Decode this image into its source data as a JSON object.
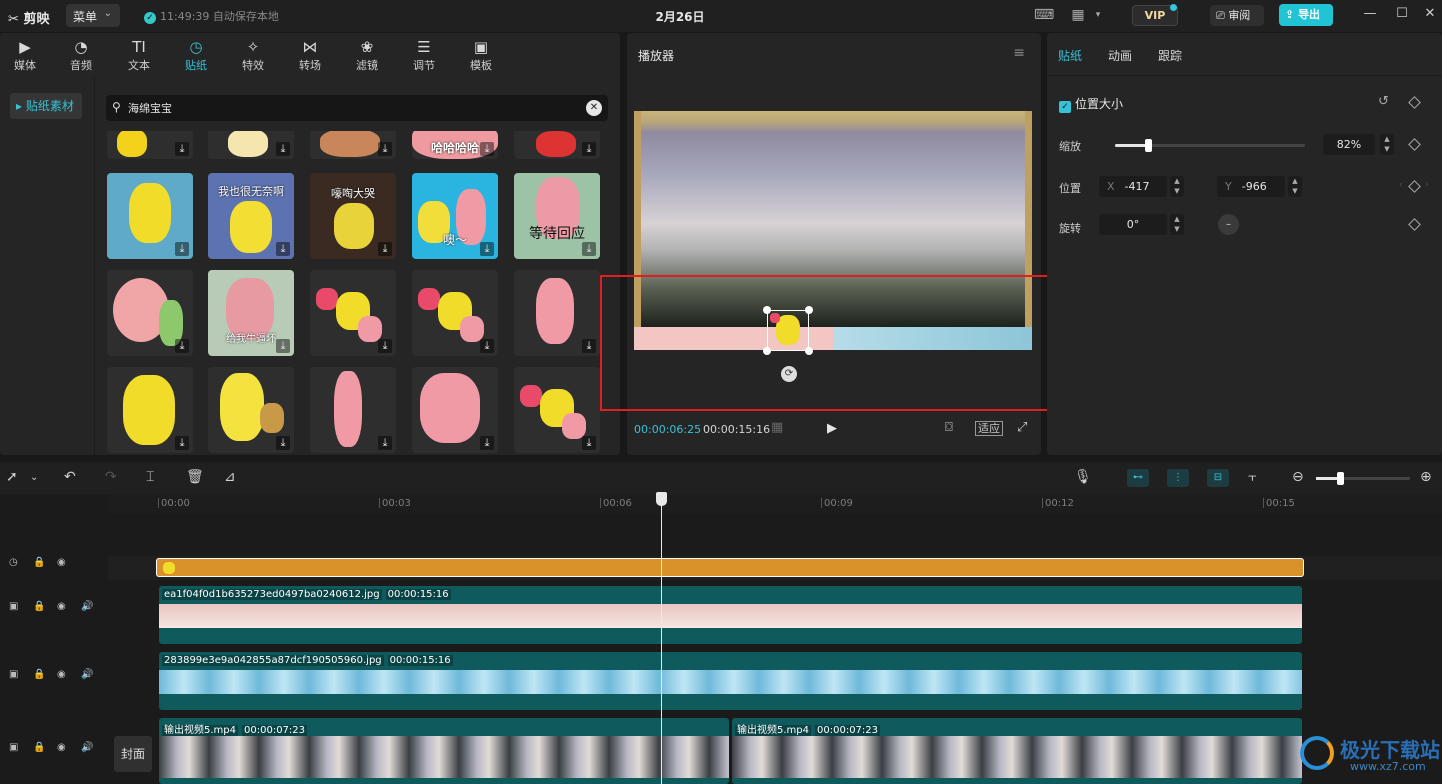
{
  "app": {
    "logo": "剪映",
    "menu_label": "菜单",
    "save_status": "11:49:39 自动保存本地",
    "project_title": "2月26日",
    "vip_label": "VIP",
    "review_label": "审阅",
    "export_label": "导出"
  },
  "media_tabs": [
    {
      "label": "媒体",
      "icon": "media-icon"
    },
    {
      "label": "音频",
      "icon": "audio-icon"
    },
    {
      "label": "文本",
      "icon": "text-icon",
      "glyph": "TI"
    },
    {
      "label": "贴纸",
      "icon": "sticker-icon",
      "active": true
    },
    {
      "label": "特效",
      "icon": "effects-icon"
    },
    {
      "label": "转场",
      "icon": "transition-icon"
    },
    {
      "label": "滤镜",
      "icon": "filter-icon"
    },
    {
      "label": "调节",
      "icon": "adjust-icon"
    },
    {
      "label": "模板",
      "icon": "template-icon"
    }
  ],
  "sidebar": {
    "items": [
      {
        "label": "贴纸素材"
      }
    ]
  },
  "search": {
    "value": "海绵宝宝"
  },
  "stickers": {
    "captions": [
      "我也很无奈啊",
      "嚎啕大哭",
      "噢～",
      "等待回应",
      "给我牛逼坏",
      "哈哈哈哈"
    ]
  },
  "player": {
    "title": "播放器",
    "current_time": "00:00:06:25",
    "total_time": "00:00:15:16",
    "fit_label": "适应"
  },
  "props": {
    "tabs": [
      "贴纸",
      "动画",
      "跟踪"
    ],
    "section_title": "位置大小",
    "scale_label": "缩放",
    "scale_value": "82%",
    "scale_fraction": 0.82,
    "position_label": "位置",
    "x_label": "X",
    "x_value": "-417",
    "y_label": "Y",
    "y_value": "-966",
    "rotate_label": "旋转",
    "rotate_value": "0°"
  },
  "timeline": {
    "ruler": [
      "00:00",
      "00:03",
      "00:06",
      "00:09",
      "00:12",
      "00:15"
    ],
    "cover_label": "封面",
    "clips": [
      {
        "name": "ea1f04f0d1b635273ed0497ba0240612.jpg",
        "duration": "00:00:15:16"
      },
      {
        "name": "283899e3e9a042855a87dcf190505960.jpg",
        "duration": "00:00:15:16"
      },
      {
        "name": "输出视频5.mp4",
        "duration": "00:00:07:23"
      },
      {
        "name": "输出视频5.mp4",
        "duration": "00:00:07:23"
      }
    ]
  },
  "watermark": {
    "text": "极光下载站",
    "url": "www.xz7.com"
  },
  "colors": {
    "accent": "#35c2d6",
    "highlight": "#e02020",
    "sticker_track": "#d9912a",
    "clip_teal": "#0f5a5c"
  }
}
